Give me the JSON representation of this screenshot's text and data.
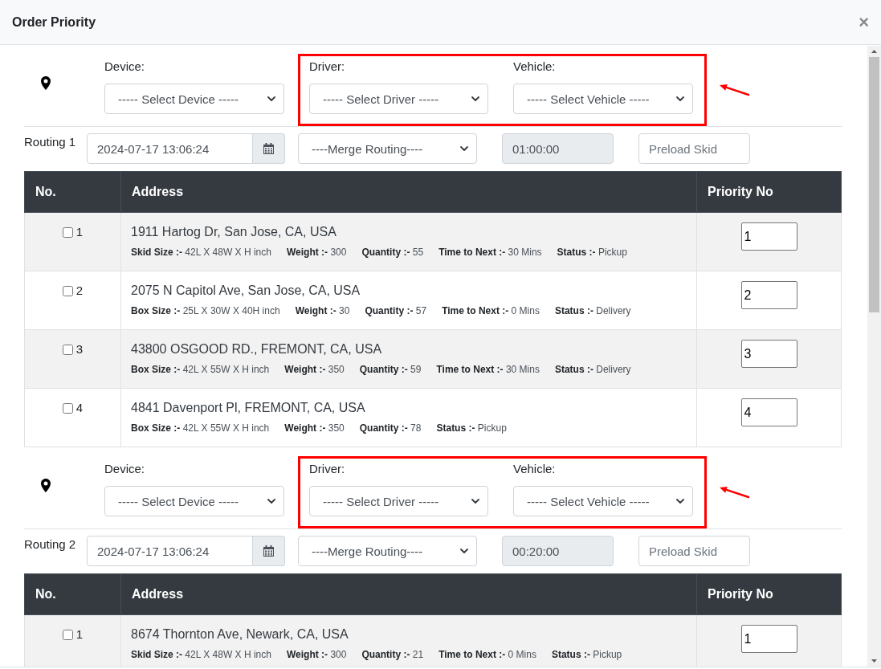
{
  "modal": {
    "title": "Order Priority",
    "close": "×"
  },
  "sections": [
    {
      "highlighted": true,
      "device": {
        "label": "Device:",
        "value": "----- Select Device -----"
      },
      "driver": {
        "label": "Driver:",
        "value": "----- Select Driver -----"
      },
      "vehicle": {
        "label": "Vehicle:",
        "value": "----- Select Vehicle -----"
      },
      "routing_label": "Routing 1",
      "date": "2024-07-17 13:06:24",
      "merge": "----Merge Routing----",
      "duration": {
        "value": "01:00:00",
        "disabled": true
      },
      "preload": {
        "placeholder": "Preload Skid"
      },
      "table": {
        "columns": [
          "No.",
          "Address",
          "Priority No"
        ],
        "rows": [
          {
            "checked": false,
            "number": "1",
            "address": "1911 Hartog Dr, San Jose, CA, USA",
            "details": [
              "**Skid Size :-** 42L X 48W X H inch",
              "**Weight :-** 300",
              "**Quantity :-** 55",
              "**Time to Next :-** 30 Mins",
              "**Status :-** Pickup"
            ],
            "priority": "1"
          },
          {
            "checked": false,
            "number": "2",
            "address": "2075 N Capitol Ave, San Jose, CA, USA",
            "details": [
              "**Box Size :-** 25L X 30W X 40H inch",
              "**Weight :-** 30",
              "**Quantity :-** 57",
              "**Time to Next :-** 0 Mins",
              "**Status :-** Delivery"
            ],
            "priority": "2"
          },
          {
            "checked": false,
            "number": "3",
            "address": "43800 OSGOOD RD., FREMONT, CA, USA",
            "details": [
              "**Box Size :-** 42L X 55W X H inch",
              "**Weight :-** 350",
              "**Quantity :-** 59",
              "**Time to Next :-** 30 Mins",
              "**Status :-** Delivery"
            ],
            "priority": "3"
          },
          {
            "checked": false,
            "number": "4",
            "address": "4841 Davenport Pl, FREMONT, CA, USA",
            "details": [
              "**Box Size :-** 42L X 55W X H inch",
              "**Weight :-** 350",
              "**Quantity :-** 78",
              "**Status :-** Pickup"
            ],
            "priority": "4"
          }
        ]
      }
    },
    {
      "highlighted": true,
      "device": {
        "label": "Device:",
        "value": "----- Select Device -----"
      },
      "driver": {
        "label": "Driver:",
        "value": "----- Select Driver -----"
      },
      "vehicle": {
        "label": "Vehicle:",
        "value": "----- Select Vehicle -----"
      },
      "routing_label": "Routing 2",
      "date": "2024-07-17 13:06:24",
      "merge": "----Merge Routing----",
      "duration": {
        "value": "00:20:00",
        "disabled": true
      },
      "preload": {
        "placeholder": "Preload Skid"
      },
      "table": {
        "columns": [
          "No.",
          "Address",
          "Priority No"
        ],
        "rows": [
          {
            "checked": false,
            "number": "1",
            "address": "8674 Thornton Ave, Newark, CA, USA",
            "details": [
              "**Skid Size :-** 42L X 48W X H inch",
              "**Weight :-** 300",
              "**Quantity :-** 21",
              "**Time to Next :-** 0 Mins",
              "**Status :-** Pickup"
            ],
            "priority": "1"
          }
        ]
      }
    }
  ]
}
